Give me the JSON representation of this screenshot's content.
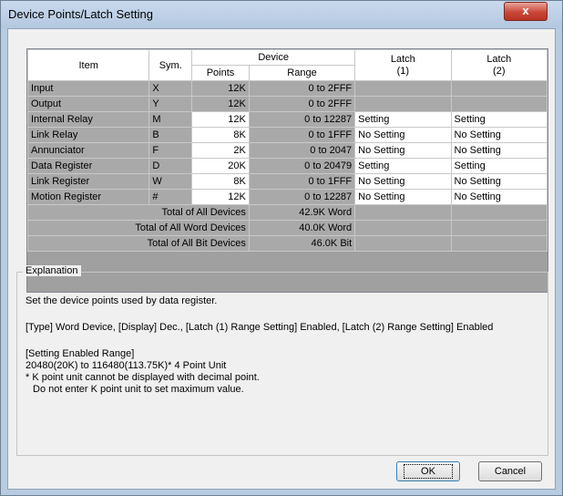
{
  "window": {
    "title": "Device Points/Latch Setting",
    "close_label": "x"
  },
  "table": {
    "headers": {
      "item": "Item",
      "sym": "Sym.",
      "device": "Device",
      "points": "Points",
      "range": "Range",
      "latch1": "Latch\n(1)",
      "latch2": "Latch\n(2)"
    },
    "rows": [
      {
        "item": "Input",
        "sym": "X",
        "points": "12K",
        "range": "0 to 2FFF",
        "latch1": "",
        "latch2": "",
        "editable": false
      },
      {
        "item": "Output",
        "sym": "Y",
        "points": "12K",
        "range": "0 to 2FFF",
        "latch1": "",
        "latch2": "",
        "editable": false
      },
      {
        "item": "Internal Relay",
        "sym": "M",
        "points": "12K",
        "range": "0 to 12287",
        "latch1": "Setting",
        "latch2": "Setting",
        "editable": true
      },
      {
        "item": "Link Relay",
        "sym": "B",
        "points": "8K",
        "range": "0 to 1FFF",
        "latch1": "No Setting",
        "latch2": "No Setting",
        "editable": true
      },
      {
        "item": "Annunciator",
        "sym": "F",
        "points": "2K",
        "range": "0 to 2047",
        "latch1": "No Setting",
        "latch2": "No Setting",
        "editable": true
      },
      {
        "item": "Data Register",
        "sym": "D",
        "points": "20K",
        "range": "0 to 20479",
        "latch1": "Setting",
        "latch2": "Setting",
        "editable": true
      },
      {
        "item": "Link Register",
        "sym": "W",
        "points": "8K",
        "range": "0 to 1FFF",
        "latch1": "No Setting",
        "latch2": "No Setting",
        "editable": true
      },
      {
        "item": "Motion Register",
        "sym": "#",
        "points": "12K",
        "range": "0 to 12287",
        "latch1": "No Setting",
        "latch2": "No Setting",
        "editable": true
      }
    ],
    "totals": [
      {
        "label": "Total of All Devices",
        "value": "42.9K Word"
      },
      {
        "label": "Total of All Word Devices",
        "value": "40.0K Word"
      },
      {
        "label": "Total of All Bit Devices",
        "value": "46.0K Bit"
      }
    ]
  },
  "explanation": {
    "legend": "Explanation",
    "line1": "Set the device points used by data register.",
    "line2": "[Type] Word Device, [Display] Dec., [Latch (1) Range Setting] Enabled, [Latch (2) Range Setting] Enabled",
    "line3": "[Setting Enabled Range]",
    "line4": "20480(20K) to 116480(113.75K)* 4 Point Unit",
    "line5": "* K point unit cannot be displayed with decimal point.",
    "line6": "Do not enter K point unit to set maximum value."
  },
  "buttons": {
    "ok": "OK",
    "cancel": "Cancel"
  }
}
